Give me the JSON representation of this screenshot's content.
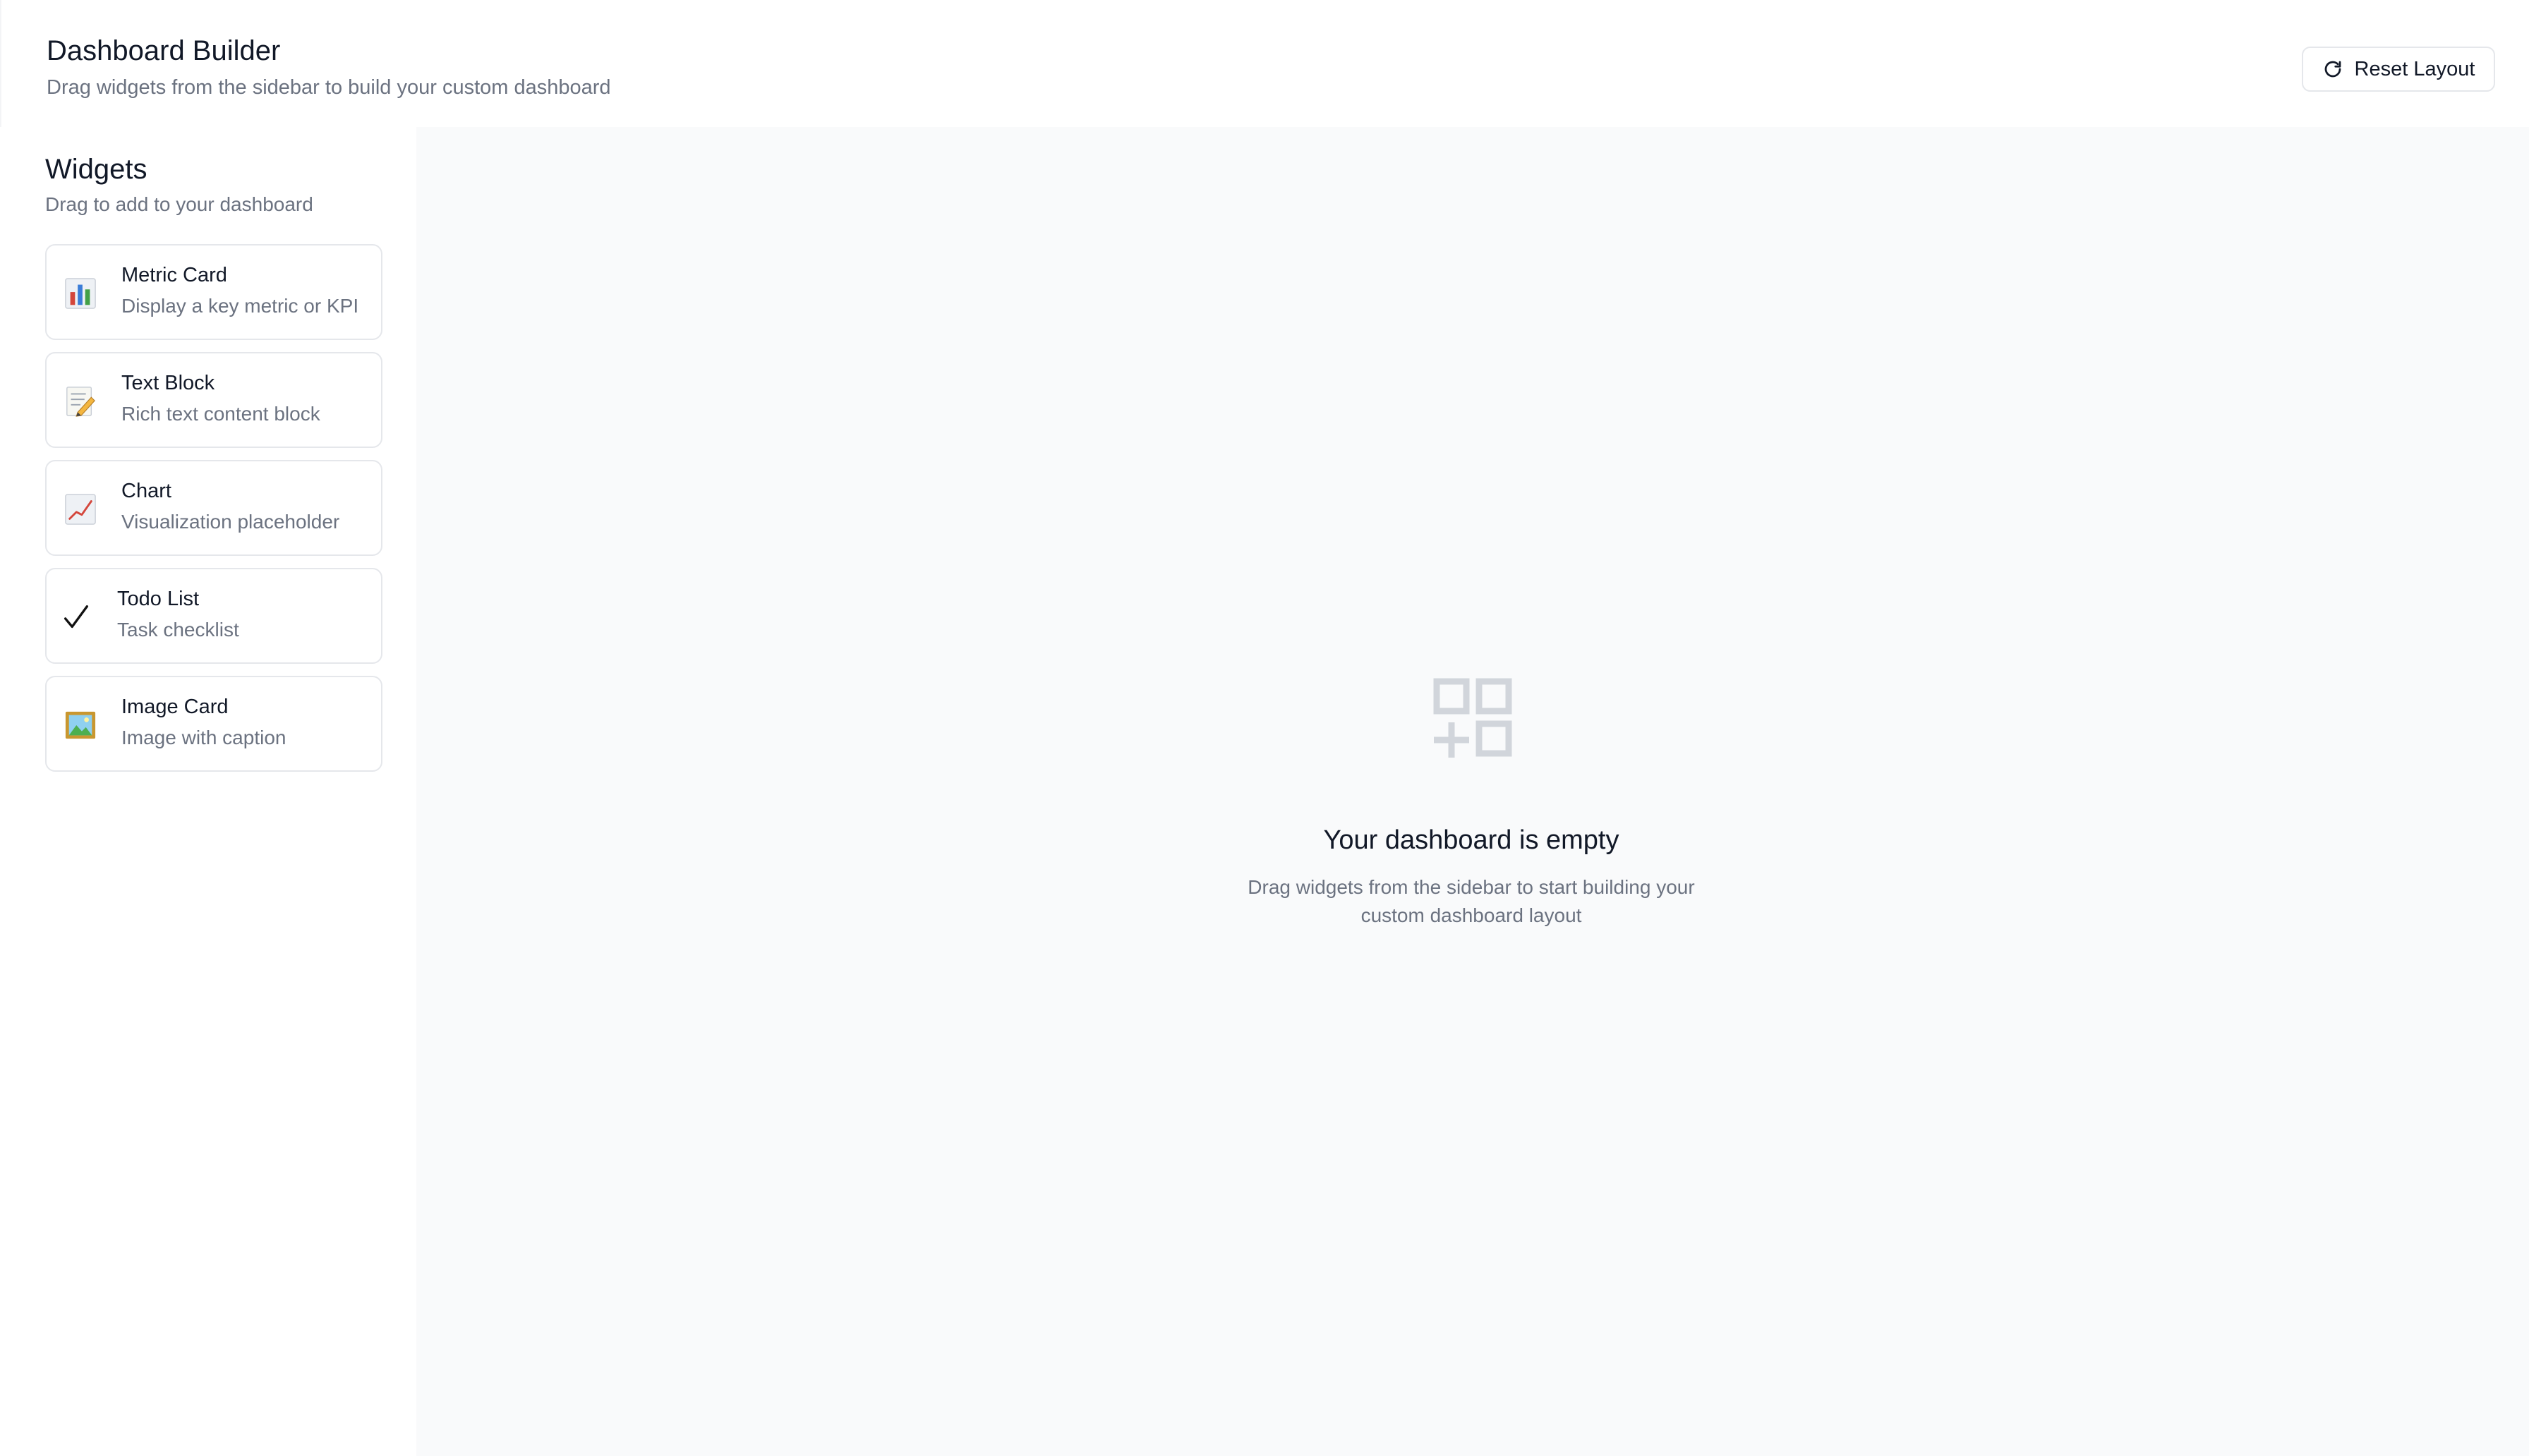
{
  "header": {
    "title": "Dashboard Builder",
    "subtitle": "Drag widgets from the sidebar to build your custom dashboard",
    "reset_label": "Reset Layout"
  },
  "sidebar": {
    "title": "Widgets",
    "subtitle": "Drag to add to your dashboard",
    "items": [
      {
        "name": "Metric Card",
        "description": "Display a key metric or KPI",
        "icon": "bar-chart-icon"
      },
      {
        "name": "Text Block",
        "description": "Rich text content block",
        "icon": "memo-icon"
      },
      {
        "name": "Chart",
        "description": "Visualization placeholder",
        "icon": "line-chart-icon"
      },
      {
        "name": "Todo List",
        "description": "Task checklist",
        "icon": "checkmark-icon"
      },
      {
        "name": "Image Card",
        "description": "Image with caption",
        "icon": "framed-picture-icon"
      }
    ]
  },
  "canvas": {
    "empty_title": "Your dashboard is empty",
    "empty_description": "Drag widgets from the sidebar to start building your custom dashboard layout",
    "empty_icon": "add-grid-icon"
  },
  "colors": {
    "text_primary": "#111827",
    "text_secondary": "#6b7280",
    "border": "#e5e7eb",
    "canvas_bg": "#f9fafb",
    "icon_muted": "#d1d5db"
  }
}
